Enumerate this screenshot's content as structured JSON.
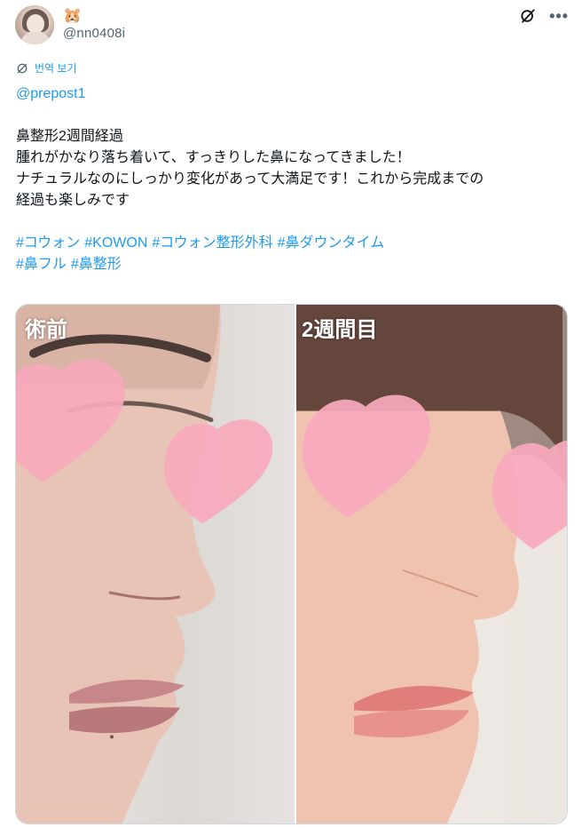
{
  "author": {
    "display_name_emoji": "🐹",
    "handle": "@nn0408i",
    "avatar_icon": "avatar-photo"
  },
  "header_icons": {
    "grok": "grok-icon",
    "more": "•••"
  },
  "translate": {
    "icon": "translate-icon",
    "label": "번역 보기"
  },
  "post": {
    "mention": "@prepost1",
    "lines": [
      "鼻整形2週間経過",
      "腫れがかなり落ち着いて、すっきりした鼻になってきました！",
      "ナチュラルなのにしっかり変化があって大満足です！これから完成までの",
      "経過も楽しみです"
    ],
    "hashtags_line1": [
      "#コウォン",
      "#KOWON",
      "#コウォン整形外科",
      "#鼻ダウンタイム"
    ],
    "hashtags_line2": [
      "#鼻フル",
      "#鼻整形"
    ]
  },
  "media": {
    "left_label": "術前",
    "right_label": "2週間目"
  },
  "colors": {
    "link": "#1d9bf0",
    "text": "#0f1419",
    "secondary": "#536471",
    "heart": "#f7a9bd"
  }
}
